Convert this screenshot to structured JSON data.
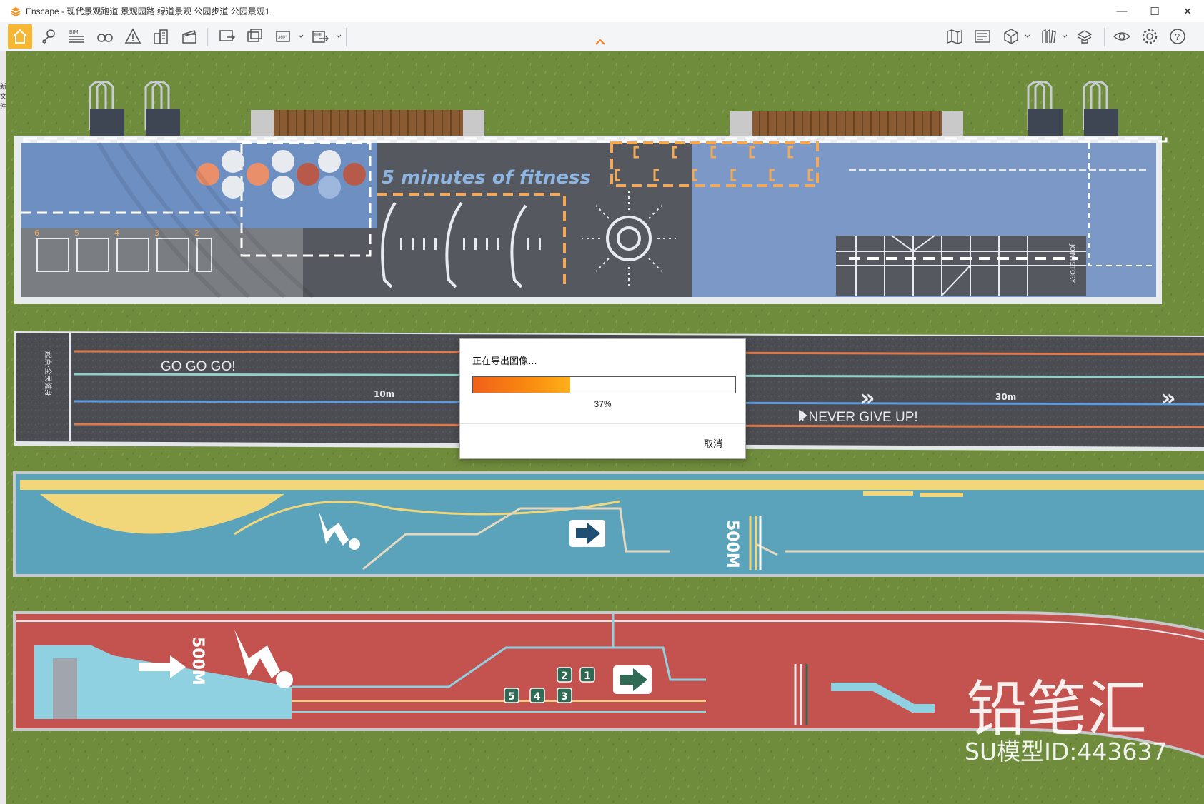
{
  "window": {
    "app_name": "Enscape",
    "title": "Enscape - 现代景观跑道 景观园路 绿道景观 公园步道 公园景观1",
    "controls": {
      "minimize": "—",
      "maximize": "☐",
      "close": "✕"
    }
  },
  "toolbar": {
    "bim_label": "BIM",
    "left_tools": [
      {
        "name": "home-icon"
      },
      {
        "name": "location-pin-icon"
      },
      {
        "name": "bim-icon"
      },
      {
        "name": "binoculars-icon"
      },
      {
        "name": "warning-triangle-icon"
      },
      {
        "name": "buildings-icon"
      },
      {
        "name": "clapperboard-icon"
      },
      {
        "name": "screenshot-export-icon"
      },
      {
        "name": "batch-render-icon"
      },
      {
        "name": "panorama-360-icon"
      },
      {
        "name": "exe-export-icon"
      }
    ],
    "badge_360": "360°",
    "badge_exe": "EXE",
    "right_tools": [
      {
        "name": "map-icon"
      },
      {
        "name": "media-library-icon"
      },
      {
        "name": "cube-icon"
      },
      {
        "name": "asset-library-icon"
      },
      {
        "name": "material-editor-icon"
      },
      {
        "name": "visibility-icon"
      },
      {
        "name": "settings-gear-icon"
      },
      {
        "name": "help-icon"
      }
    ],
    "help_symbol": "?"
  },
  "left_strip_text": "新\n文\n件",
  "scene": {
    "track1": {
      "fitness_text": "5 minutes of fitness",
      "numbers": [
        "6",
        "5",
        "4",
        "3",
        "2"
      ],
      "vertical_text": "JOINTSTORY"
    },
    "track2": {
      "text_go": "GO GO GO!",
      "text_never": "I NEVER  GIVE UP!",
      "label_10m": "10m",
      "label_30m": "30m",
      "start_vertical": "起点·全民健身",
      "chevrons": "»"
    },
    "track3": {
      "label_500m": "500M"
    },
    "track4": {
      "label_500m": "500M",
      "numbers": [
        "1",
        "2",
        "3",
        "4",
        "5"
      ]
    },
    "watermark_brand": "铅笔汇",
    "watermark_id": "SU模型ID:443637"
  },
  "dialog": {
    "title": "正在导出图像…",
    "progress": 0.37,
    "progress_text": "37%",
    "cancel_label": "取消"
  },
  "colors": {
    "accent": "#f7b733",
    "progress_start": "#f0601a",
    "progress_end": "#ffb01a",
    "grass": "#6e8a3a"
  }
}
